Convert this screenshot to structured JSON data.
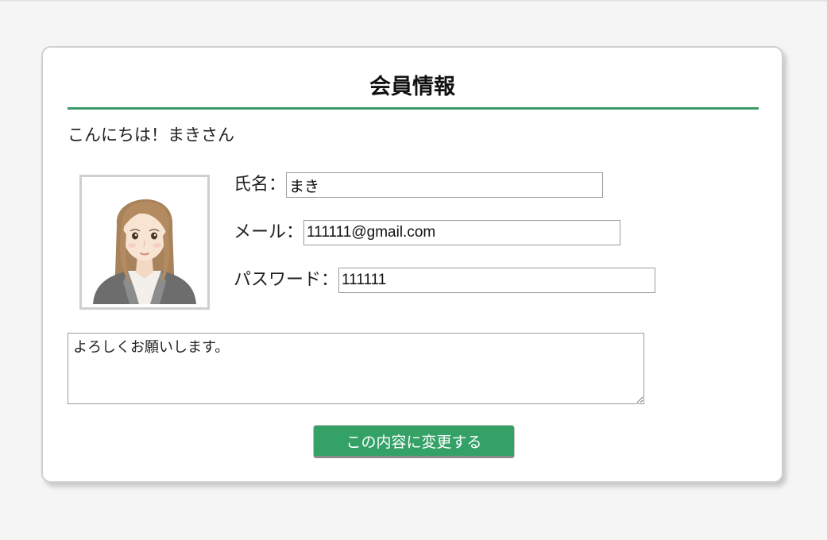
{
  "page": {
    "title": "会員情報",
    "greeting": "こんにちは！まきさん"
  },
  "avatar": {
    "icon": "woman-avatar-icon"
  },
  "form": {
    "name_label": "氏名：",
    "name_value": "まき",
    "email_label": "メール：",
    "email_value": "111111@gmail.com",
    "password_label": "パスワード：",
    "password_value": "111111",
    "memo_value": "よろしくお願いします。",
    "submit_label": "この内容に変更する"
  },
  "colors": {
    "accent": "#3a9a68",
    "button": "#34a267"
  }
}
